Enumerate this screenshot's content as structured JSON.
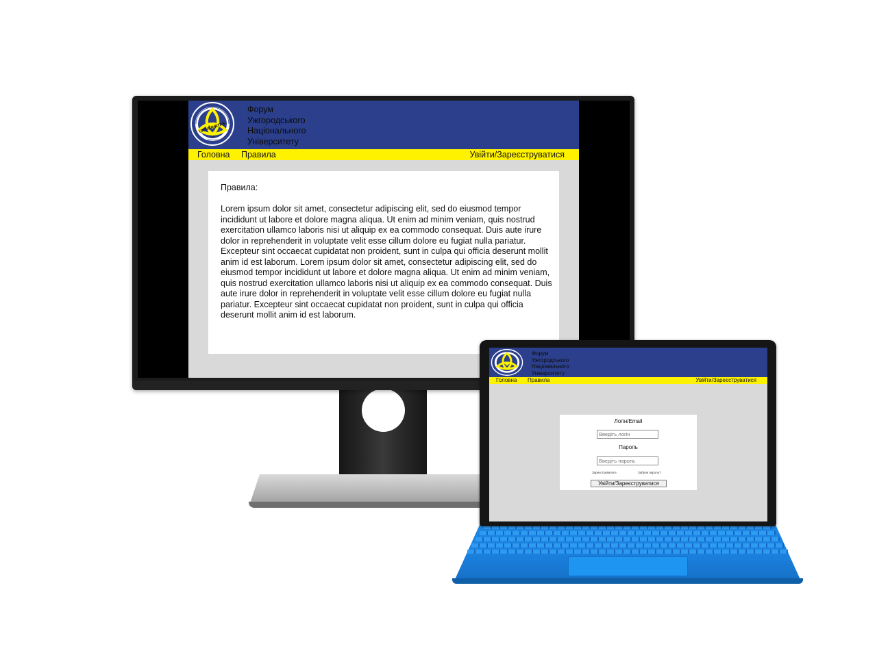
{
  "forum": {
    "title_lines": [
      "Форум",
      "Ужгородського",
      "Національного",
      "Університету"
    ],
    "logo": {
      "text_top": "UNIVERSITAS",
      "text_bottom": "УНІВЕРСИТЕТ",
      "year": "1945"
    }
  },
  "nav": {
    "home": "Головна",
    "rules": "Правила",
    "login_register": "Увійти/Зареєструватися"
  },
  "rules_page": {
    "heading": "Правила:",
    "body": "Lorem ipsum dolor sit amet, consectetur adipiscing elit, sed do eiusmod tempor incididunt ut labore et dolore magna aliqua. Ut enim ad minim veniam, quis nostrud exercitation ullamco laboris nisi ut aliquip ex ea commodo consequat. Duis aute irure dolor in reprehenderit in voluptate velit esse cillum dolore eu fugiat nulla pariatur. Excepteur sint occaecat cupidatat non proident, sunt in culpa qui officia deserunt mollit anim id est laborum. Lorem ipsum dolor sit amet, consectetur adipiscing elit, sed do eiusmod tempor incididunt ut labore et dolore magna aliqua. Ut enim ad minim veniam, quis nostrud exercitation ullamco laboris nisi ut aliquip ex ea commodo consequat. Duis aute irure dolor in reprehenderit in voluptate velit esse cillum dolore eu fugiat nulla pariatur. Excepteur sint occaecat cupidatat non proident, sunt in culpa qui officia deserunt mollit anim id est laborum."
  },
  "login_page": {
    "login_label": "Логін/Email",
    "login_placeholder": "Введіть логін",
    "password_label": "Пароль",
    "password_placeholder": "Введіть пароль",
    "register_link": "Зареєструватися",
    "forgot_link": "Забули пароль?",
    "submit_label": "Увійти/Зареєструватися"
  },
  "colors": {
    "header_blue": "#2b3f8c",
    "nav_yellow": "#fff200",
    "page_gray": "#d9d9d9",
    "keyboard_blue": "#1e88e5"
  }
}
